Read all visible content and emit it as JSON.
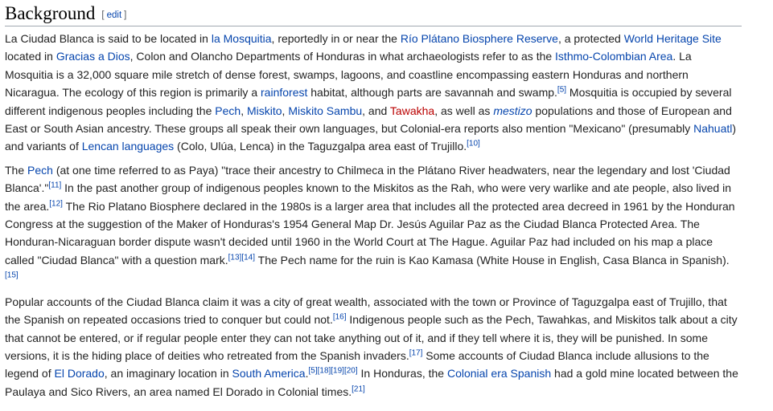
{
  "section": {
    "title": "Background",
    "edit_label": "edit",
    "bracket_open": "[",
    "bracket_close": "]"
  },
  "paragraphs": [
    [
      {
        "t": "La Ciudad Blanca is said to be located in "
      },
      {
        "t": "la Mosquitia",
        "type": "link"
      },
      {
        "t": ", reportedly in or near the "
      },
      {
        "t": "Río Plátano Biosphere Reserve",
        "type": "link"
      },
      {
        "t": ", a protected "
      },
      {
        "t": "World Heritage Site",
        "type": "link"
      },
      {
        "t": " located in "
      },
      {
        "t": "Gracias a Dios",
        "type": "link"
      },
      {
        "t": ", Colon and Olancho Departments of Honduras in what archaeologists refer to as the "
      },
      {
        "t": "Isthmo-Colombian Area",
        "type": "link"
      },
      {
        "t": ". La Mosquitia is a 32,000 square mile stretch of dense forest, swamps, lagoons, and coastline encompassing eastern Honduras and northern Nicaragua. The ecology of this region is primarily a "
      },
      {
        "t": "rainforest",
        "type": "link"
      },
      {
        "t": " habitat, although parts are savannah and swamp."
      },
      {
        "t": "[5]",
        "type": "ref"
      },
      {
        "t": " Mosquitia is occupied by several different indigenous peoples including the "
      },
      {
        "t": "Pech",
        "type": "link"
      },
      {
        "t": ", "
      },
      {
        "t": "Miskito",
        "type": "link"
      },
      {
        "t": ", "
      },
      {
        "t": "Miskito Sambu",
        "type": "link"
      },
      {
        "t": ", and "
      },
      {
        "t": "Tawakha",
        "type": "new"
      },
      {
        "t": ", as well as "
      },
      {
        "t": "mestizo",
        "type": "link",
        "italic": true
      },
      {
        "t": " populations and those of European and East or South Asian ancestry. These groups all speak their own languages, but Colonial-era reports also mention \"Mexicano\" (presumably "
      },
      {
        "t": "Nahuatl",
        "type": "link"
      },
      {
        "t": ") and variants of "
      },
      {
        "t": "Lencan languages",
        "type": "link"
      },
      {
        "t": " (Colo, Ulúa, Lenca) in the Taguzgalpa area east of Trujillo."
      },
      {
        "t": "[10]",
        "type": "ref"
      }
    ],
    [
      {
        "t": "The "
      },
      {
        "t": "Pech",
        "type": "link"
      },
      {
        "t": " (at one time referred to as Paya) \"trace their ancestry to Chilmeca in the Plátano River headwaters, near the legendary and lost 'Ciudad Blanca'.\""
      },
      {
        "t": "[11]",
        "type": "ref"
      },
      {
        "t": " In the past another group of indigenous peoples known to the Miskitos as the Rah, who were very warlike and ate people, also lived in the area."
      },
      {
        "t": "[12]",
        "type": "ref"
      },
      {
        "t": " The Rio Platano Biosphere declared in the 1980s is a larger area that includes all the protected area decreed in 1961 by the Honduran Congress at the suggestion of the Maker of Honduras's 1954 General Map Dr. Jesús Aguilar Paz as the Ciudad Blanca Protected Area. The Honduran-Nicaraguan border dispute wasn't decided until 1960 in the World Court at The Hague. Aguilar Paz had included on his map a place called \"Ciudad Blanca\" with a question mark."
      },
      {
        "t": "[13][14]",
        "type": "ref"
      },
      {
        "t": " The Pech name for the ruin is Kao Kamasa (White House in English, Casa Blanca in Spanish)."
      },
      {
        "t": "[15]",
        "type": "ref"
      }
    ],
    [
      {
        "t": "Popular accounts of the Ciudad Blanca claim it was a city of great wealth, associated with the town or Province of Taguzgalpa east of Trujillo, that the Spanish on repeated occasions tried to conquer but could not."
      },
      {
        "t": "[16]",
        "type": "ref"
      },
      {
        "t": " Indigenous people such as the Pech, Tawahkas, and Miskitos talk about a city that cannot be entered, or if regular people enter they can not take anything out of it, and if they tell where it is, they will be punished. In some versions, it is the hiding place of deities who retreated from the Spanish invaders."
      },
      {
        "t": "[17]",
        "type": "ref"
      },
      {
        "t": " Some accounts of Ciudad Blanca include allusions to the legend of "
      },
      {
        "t": "El Dorado",
        "type": "link"
      },
      {
        "t": ", an imaginary location in "
      },
      {
        "t": "South America",
        "type": "link"
      },
      {
        "t": "."
      },
      {
        "t": "[5][18][19][20]",
        "type": "ref"
      },
      {
        "t": " In Honduras, the "
      },
      {
        "t": "Colonial era Spanish",
        "type": "link"
      },
      {
        "t": " had a gold mine located between the Paulaya and Sico Rivers, an area named El Dorado in Colonial times."
      },
      {
        "t": "[21]",
        "type": "ref"
      }
    ]
  ],
  "colors": {
    "text": "#222222",
    "link": "#0645ad",
    "new_link": "#ba0000",
    "rule": "#a2a9b1"
  }
}
